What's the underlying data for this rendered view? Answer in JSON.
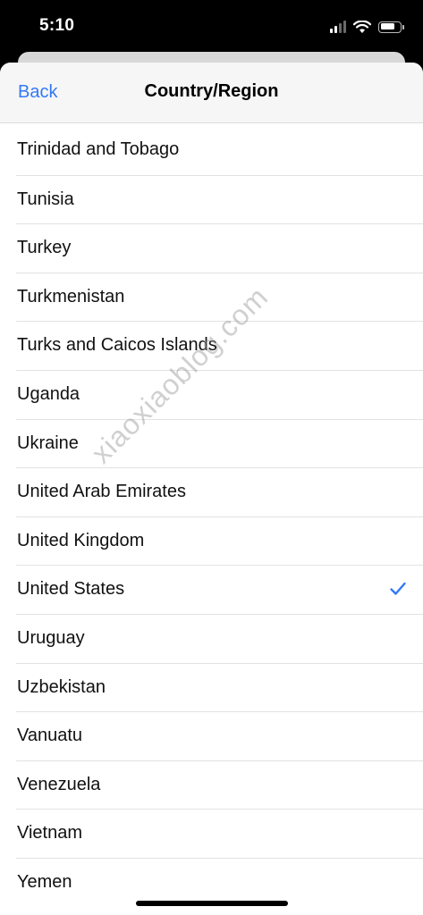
{
  "status": {
    "time": "5:10",
    "icons": [
      "cellular-signal-icon",
      "wifi-icon",
      "battery-icon"
    ]
  },
  "nav": {
    "back_label": "Back",
    "title": "Country/Region"
  },
  "countries": [
    {
      "label": "Trinidad and Tobago",
      "selected": false
    },
    {
      "label": "Tunisia",
      "selected": false
    },
    {
      "label": "Turkey",
      "selected": false
    },
    {
      "label": "Turkmenistan",
      "selected": false
    },
    {
      "label": "Turks and Caicos Islands",
      "selected": false
    },
    {
      "label": "Uganda",
      "selected": false
    },
    {
      "label": "Ukraine",
      "selected": false
    },
    {
      "label": "United Arab Emirates",
      "selected": false
    },
    {
      "label": "United Kingdom",
      "selected": false
    },
    {
      "label": "United States",
      "selected": true
    },
    {
      "label": "Uruguay",
      "selected": false
    },
    {
      "label": "Uzbekistan",
      "selected": false
    },
    {
      "label": "Vanuatu",
      "selected": false
    },
    {
      "label": "Venezuela",
      "selected": false
    },
    {
      "label": "Vietnam",
      "selected": false
    },
    {
      "label": "Yemen",
      "selected": false
    }
  ],
  "watermark": "xiaoxiaoblog.com",
  "colors": {
    "accent": "#3478f6",
    "nav_background": "#f6f6f6",
    "separator": "#e2e2e2"
  }
}
